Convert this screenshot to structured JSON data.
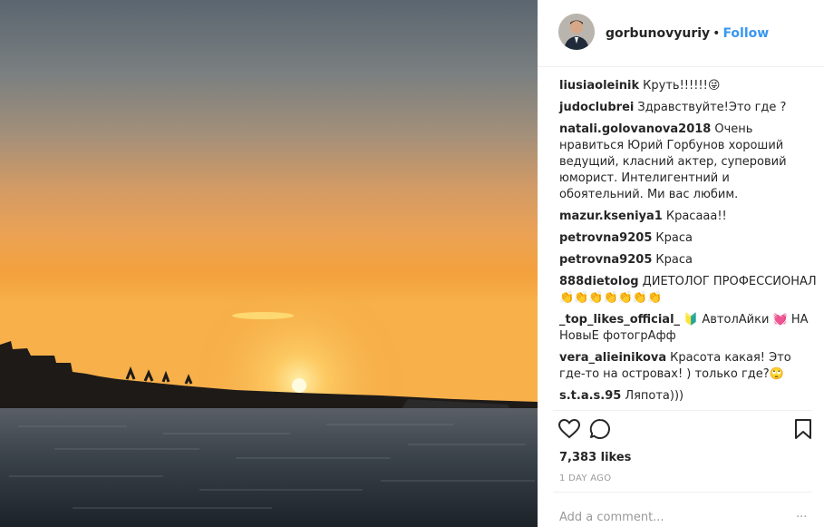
{
  "post": {
    "username": "gorbunovyuriy",
    "dot": "•",
    "follow_label": "Follow"
  },
  "comments": [
    {
      "user": "liusiaoleinik",
      "text": "Круть!!!!!!😜"
    },
    {
      "user": "judoclubrei",
      "text": "Здравствуйте!Это где ?"
    },
    {
      "user": "natali.golovanova2018",
      "text": "Очень нравиться Юрий Горбунов хороший ведущий, класний актер, суперовий юморист. Интелигентний и обоятельний. Ми вас любим."
    },
    {
      "user": "mazur.kseniya1",
      "text": "Красааа!!"
    },
    {
      "user": "petrovna9205",
      "text": "Краса"
    },
    {
      "user": "petrovna9205",
      "text": "Краса"
    },
    {
      "user": "888dietolog",
      "text": "ДИЕТОЛОГ ПРОФЕССИОНАЛ 👏👏👏👏👏👏👏"
    },
    {
      "user": "_top_likes_official_",
      "text": "🔰 АвтолАйки 💓 НА НовыЕ фотогрАфф"
    },
    {
      "user": "vera_alieinikova",
      "text": "Красота какая! Это где-то на островах! ) только где?🙄"
    },
    {
      "user": "s.t.a.s.95",
      "text": "Ляпота)))"
    }
  ],
  "actions": {
    "like_icon": "heart-outline-icon",
    "comment_icon": "comment-bubble-icon",
    "save_icon": "bookmark-icon"
  },
  "likes_text": "7,383 likes",
  "time_text": "1 DAY AGO",
  "add_comment_placeholder": "Add a comment...",
  "more_text": "···",
  "colors": {
    "follow": "#3897f0",
    "text": "#262626",
    "muted": "#999999",
    "sky_top": "#5f6a73",
    "horizon": "#f3a13b",
    "sun": "#fff6cc"
  }
}
